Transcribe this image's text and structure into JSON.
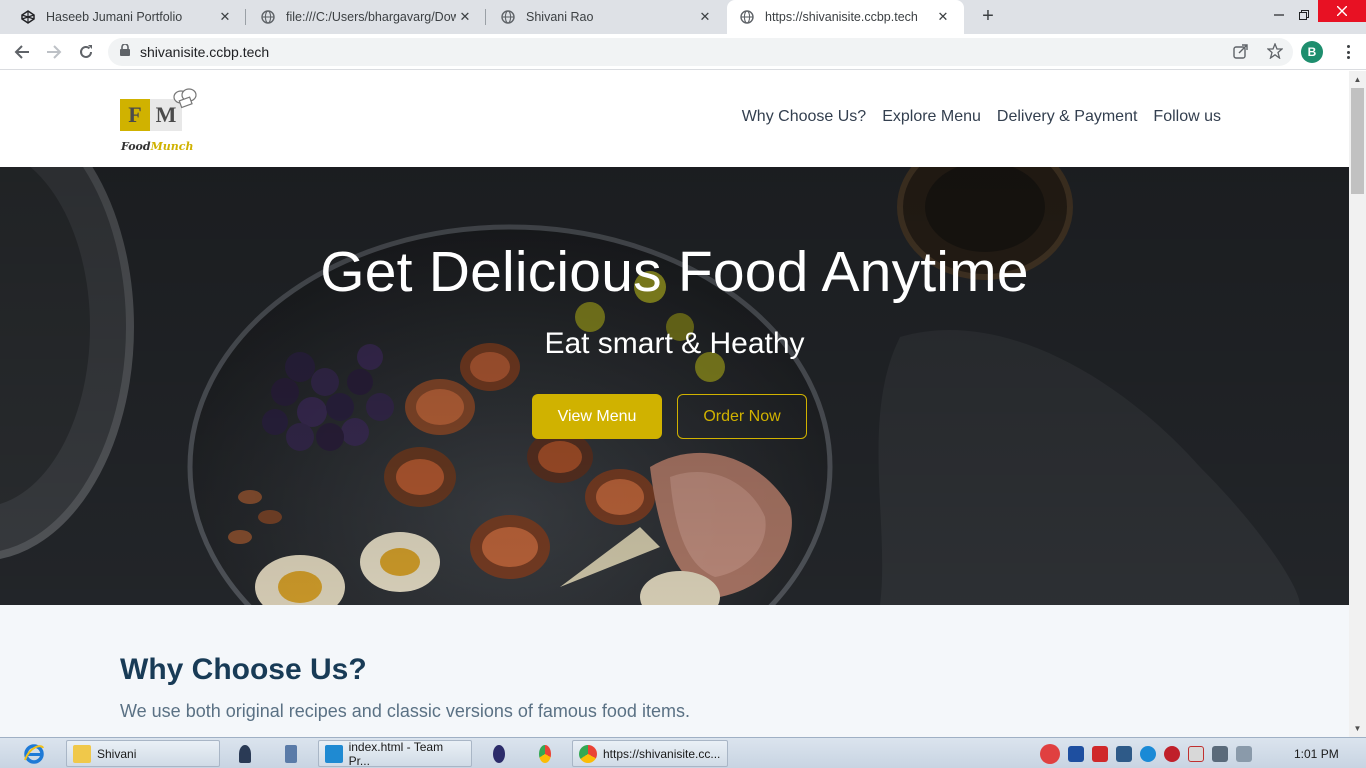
{
  "browser": {
    "tabs": [
      {
        "title": "Haseeb Jumani Portfolio",
        "icon": "codepen-icon",
        "active": false
      },
      {
        "title": "file:///C:/Users/bhargavarg/Down",
        "icon": "globe-icon",
        "active": false
      },
      {
        "title": "Shivani Rao",
        "icon": "globe-icon",
        "active": false
      },
      {
        "title": "https://shivanisite.ccbp.tech",
        "icon": "globe-icon",
        "active": true
      }
    ],
    "new_tab": "+",
    "address": "shivanisite.ccbp.tech",
    "profile_initial": "B"
  },
  "site": {
    "logo": {
      "mark_f": "F",
      "mark_m": "M",
      "brand_food": "Food",
      "brand_munch": "Munch"
    },
    "nav": [
      "Why Choose Us?",
      "Explore Menu",
      "Delivery & Payment",
      "Follow us"
    ],
    "hero": {
      "title": "Get Delicious Food Anytime",
      "subtitle": "Eat smart & Heathy",
      "primary_button": "View Menu",
      "secondary_button": "Order Now"
    },
    "why": {
      "heading": "Why Choose Us?",
      "text": "We use both original recipes and classic versions of famous food items."
    }
  },
  "taskbar": {
    "items": [
      {
        "label": "Shivani",
        "icon": "folder-icon"
      },
      {
        "label": "index.html - Team Pr...",
        "icon": "vscode-icon"
      },
      {
        "label": "https://shivanisite.cc...",
        "icon": "chrome-icon"
      }
    ],
    "clock": "1:01 PM"
  },
  "colors": {
    "accent": "#d0b200",
    "heading": "#183b56",
    "nav_text": "#333f4f",
    "section_bg": "#f4f7fa"
  }
}
